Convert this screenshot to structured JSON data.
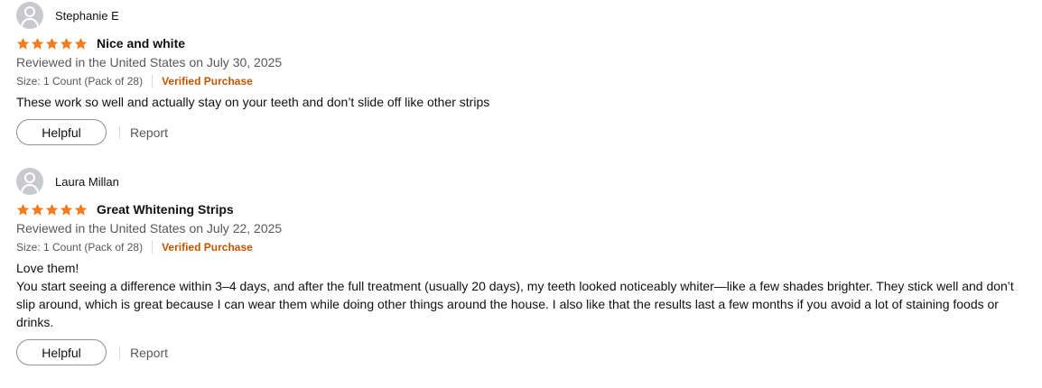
{
  "reviews": [
    {
      "name": "Stephanie E",
      "title": "Nice and white",
      "rating": 5,
      "date": "Reviewed in the United States on July 30, 2025",
      "size": "Size: 1 Count (Pack of 28)",
      "verified": "Verified Purchase",
      "body_lines": [
        "These work so well and actually stay on your teeth and don’t slide off like other strips"
      ],
      "helpful_label": "Helpful",
      "report_label": "Report"
    },
    {
      "name": "Laura Millan",
      "title": "Great Whitening Strips",
      "rating": 5,
      "date": "Reviewed in the United States on July 22, 2025",
      "size": "Size: 1 Count (Pack of 28)",
      "verified": "Verified Purchase",
      "body_lines": [
        "Love them!",
        "You start seeing a difference within 3–4 days, and after the full treatment (usually 20 days), my teeth looked noticeably whiter—like a few shades brighter. They stick well and don’t slip around, which is great because I can wear them while doing other things around the house. I also like that the results last a few months if you avoid a lot of staining foods or drinks."
      ],
      "helpful_label": "Helpful",
      "report_label": "Report"
    }
  ],
  "colors": {
    "star": "#f47b20",
    "verified": "#c45500",
    "muted_text": "#565959"
  },
  "icons": {
    "avatar": "user-silhouette-icon",
    "star": "star-filled-icon"
  }
}
